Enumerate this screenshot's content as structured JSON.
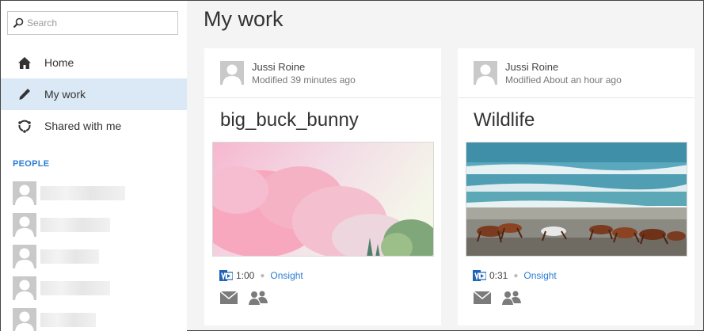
{
  "search": {
    "placeholder": "Search"
  },
  "nav": [
    {
      "label": "Home",
      "icon": "home-icon"
    },
    {
      "label": "My work",
      "icon": "pencil-icon",
      "active": true
    },
    {
      "label": "Shared with me",
      "icon": "share-icon"
    }
  ],
  "people": {
    "label": "PEOPLE"
  },
  "page": {
    "title": "My work"
  },
  "cards": [
    {
      "owner": "Jussi Roine",
      "modified": "Modified 39 minutes ago",
      "title": "big_buck_bunny",
      "duration": "1:00",
      "channel": "Onsight"
    },
    {
      "owner": "Jussi Roine",
      "modified": "Modified About an hour ago",
      "title": "Wildlife",
      "duration": "0:31",
      "channel": "Onsight"
    }
  ],
  "colors": {
    "accent": "#2b7cd3",
    "active_bg": "#dbe9f7"
  }
}
